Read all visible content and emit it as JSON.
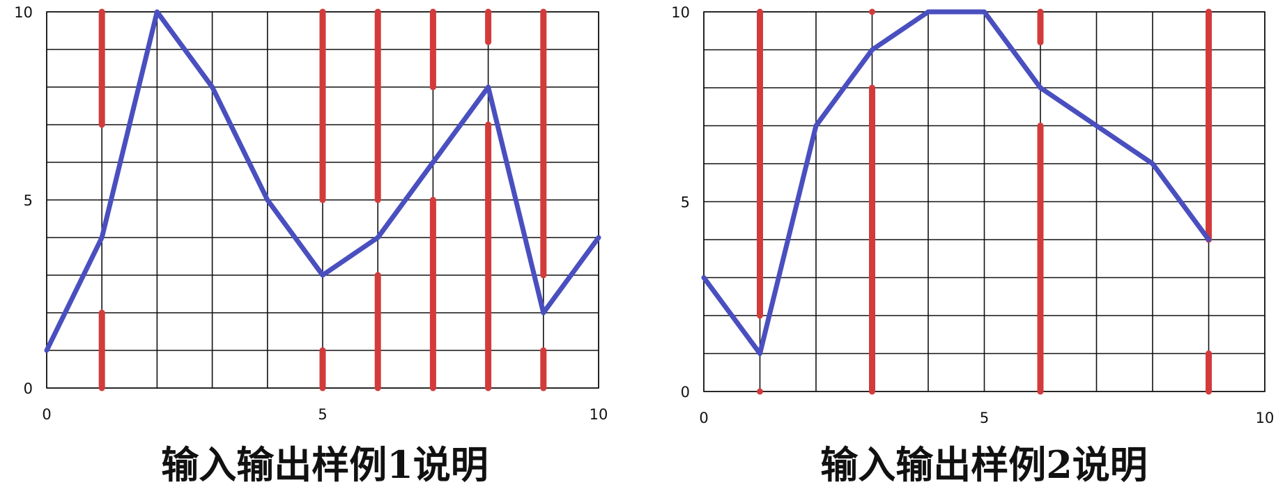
{
  "chart_data": [
    {
      "type": "line",
      "caption": "输入输出样例1说明",
      "xlim": [
        0,
        10
      ],
      "ylim": [
        0,
        10
      ],
      "x_tick_labels": [
        "0",
        "5",
        "10"
      ],
      "y_tick_labels": [
        "0",
        "5",
        "10"
      ],
      "grid": true,
      "series": [
        {
          "color": "#4a4fbf",
          "x": [
            0,
            1,
            2,
            3,
            4,
            5,
            6,
            7,
            8,
            9,
            10
          ],
          "y": [
            1,
            4,
            10,
            8,
            5,
            3,
            4,
            6,
            8,
            2,
            4
          ]
        }
      ],
      "segments": {
        "color": "#d33b3b",
        "items": [
          {
            "x": 1,
            "y0": 7,
            "y1": 10
          },
          {
            "x": 1,
            "y0": 0,
            "y1": 2
          },
          {
            "x": 5,
            "y0": 5,
            "y1": 10
          },
          {
            "x": 5,
            "y0": 0,
            "y1": 1
          },
          {
            "x": 6,
            "y0": 5,
            "y1": 10
          },
          {
            "x": 6,
            "y0": 0,
            "y1": 3
          },
          {
            "x": 7,
            "y0": 8,
            "y1": 10
          },
          {
            "x": 7,
            "y0": 0,
            "y1": 5
          },
          {
            "x": 8,
            "y0": 9.2,
            "y1": 10
          },
          {
            "x": 8,
            "y0": 0,
            "y1": 7
          },
          {
            "x": 9,
            "y0": 3,
            "y1": 10
          },
          {
            "x": 9,
            "y0": 0,
            "y1": 1
          }
        ]
      }
    },
    {
      "type": "line",
      "caption": "输入输出样例2说明",
      "xlim": [
        0,
        10
      ],
      "ylim": [
        0,
        10
      ],
      "x_tick_labels": [
        "0",
        "5",
        "10"
      ],
      "y_tick_labels": [
        "0",
        "5",
        "10"
      ],
      "grid": true,
      "series": [
        {
          "color": "#4a4fbf",
          "x": [
            0,
            1,
            2,
            3,
            4,
            5,
            6,
            7,
            8,
            9
          ],
          "y": [
            3,
            1,
            7,
            9,
            10,
            10,
            8,
            7,
            6,
            4
          ]
        }
      ],
      "segments": {
        "color": "#d33b3b",
        "items": [
          {
            "x": 1,
            "y0": 2,
            "y1": 10
          },
          {
            "x": 1,
            "y0": 0,
            "y1": 0
          },
          {
            "x": 3,
            "y0": 10,
            "y1": 10
          },
          {
            "x": 3,
            "y0": 0,
            "y1": 8
          },
          {
            "x": 6,
            "y0": 9.2,
            "y1": 10
          },
          {
            "x": 6,
            "y0": 0,
            "y1": 7
          },
          {
            "x": 9,
            "y0": 4,
            "y1": 10
          },
          {
            "x": 9,
            "y0": 0,
            "y1": 1
          }
        ]
      }
    }
  ]
}
